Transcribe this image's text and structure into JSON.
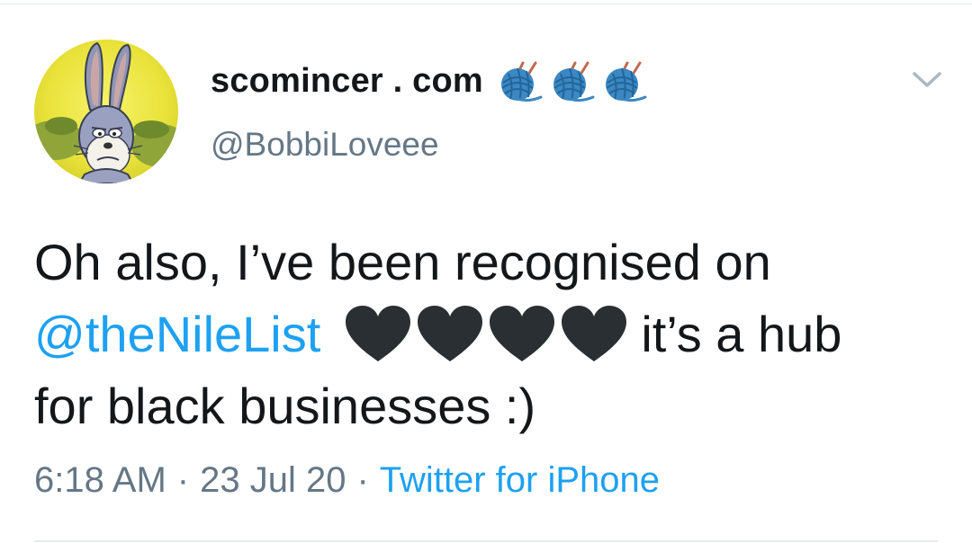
{
  "tweet": {
    "author": {
      "display_name": "scomincer . com",
      "handle": "@BobbiLoveee",
      "name_emojis": [
        "yarn-knitting-emoji",
        "yarn-knitting-emoji",
        "yarn-knitting-emoji"
      ]
    },
    "text": {
      "line1": "Oh also, I’ve been recognised on",
      "mention": "@theNileList",
      "hearts": [
        "black-heart-emoji",
        "black-heart-emoji",
        "black-heart-emoji",
        "black-heart-emoji"
      ],
      "line2_tail": "it’s a hub",
      "line3": "for black businesses :)"
    },
    "meta": {
      "time": "6:18 AM",
      "separator": "·",
      "date": "23 Jul 20",
      "source": "Twitter for iPhone"
    }
  },
  "colors": {
    "text": "#14171a",
    "secondary": "#657786",
    "link": "#1da1f2",
    "divider": "#e6ecf0",
    "heart": "#292f33",
    "yarn": "#3b88c3"
  },
  "icons": {
    "avatar": "bugs-bunny-avatar",
    "caret": "chevron-down-icon"
  }
}
